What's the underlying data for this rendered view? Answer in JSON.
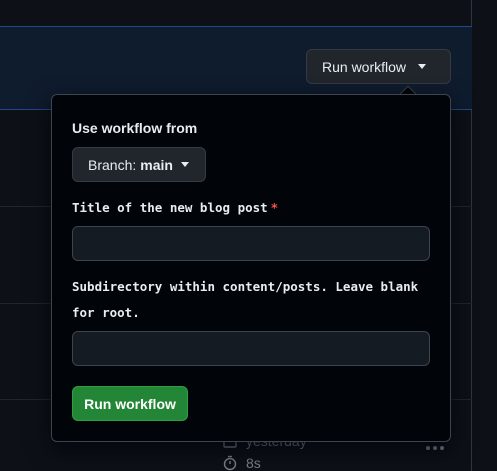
{
  "header": {
    "run_workflow_label": "Run workflow"
  },
  "popover": {
    "heading": "Use workflow from",
    "branch_prefix": "Branch:",
    "branch_name": "main",
    "fields": [
      {
        "label": "Title of the new blog post",
        "required": true,
        "value": ""
      },
      {
        "label": "Subdirectory within content/posts. Leave blank for root.",
        "required": false,
        "value": ""
      }
    ],
    "submit_label": "Run workflow"
  },
  "background_run": {
    "time_ago": "yesterday",
    "duration": "8s"
  },
  "icons": [
    "caret-down-icon",
    "calendar-icon",
    "stopwatch-icon",
    "kebab-icon"
  ],
  "colors": {
    "accent_green": "#238636",
    "required_red": "#f85149",
    "banner_border": "#1f4a8a"
  }
}
